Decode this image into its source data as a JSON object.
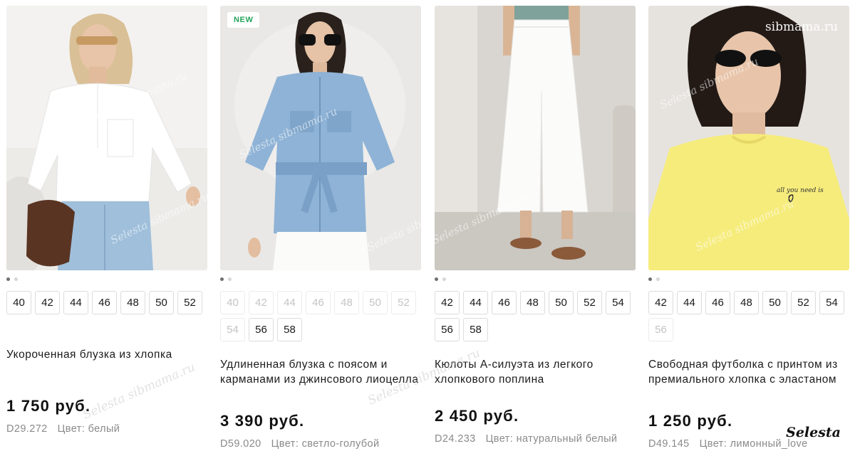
{
  "watermarks": {
    "site": "sibmama.ru",
    "brand": "Selesta sibmama.ru",
    "signature": "Selesta"
  },
  "products": [
    {
      "badge": "",
      "sizes": [
        {
          "label": "40",
          "available": true
        },
        {
          "label": "42",
          "available": true
        },
        {
          "label": "44",
          "available": true
        },
        {
          "label": "46",
          "available": true
        },
        {
          "label": "48",
          "available": true
        },
        {
          "label": "50",
          "available": true
        },
        {
          "label": "52",
          "available": true
        }
      ],
      "title": "Укороченная блузка из хлопка",
      "price": "1 750 руб.",
      "code": "D29.272",
      "color": "Цвет: белый"
    },
    {
      "badge": "NEW",
      "sizes": [
        {
          "label": "40",
          "available": false
        },
        {
          "label": "42",
          "available": false
        },
        {
          "label": "44",
          "available": false
        },
        {
          "label": "46",
          "available": false
        },
        {
          "label": "48",
          "available": false
        },
        {
          "label": "50",
          "available": false
        },
        {
          "label": "52",
          "available": false
        },
        {
          "label": "54",
          "available": false
        },
        {
          "label": "56",
          "available": true
        },
        {
          "label": "58",
          "available": true
        }
      ],
      "title": "Удлиненная блузка с поясом и карманами из джинсового лиоцелла",
      "price": "3 390 руб.",
      "code": "D59.020",
      "color": "Цвет: светло-голубой"
    },
    {
      "badge": "",
      "sizes": [
        {
          "label": "42",
          "available": true
        },
        {
          "label": "44",
          "available": true
        },
        {
          "label": "46",
          "available": true
        },
        {
          "label": "48",
          "available": true
        },
        {
          "label": "50",
          "available": true
        },
        {
          "label": "52",
          "available": true
        },
        {
          "label": "54",
          "available": true
        },
        {
          "label": "56",
          "available": true
        },
        {
          "label": "58",
          "available": true
        }
      ],
      "title": "Кюлоты А-силуэта из легкого хлопкового поплина",
      "price": "2 450 руб.",
      "code": "D24.233",
      "color": "Цвет: натуральный белый"
    },
    {
      "badge": "",
      "sizes": [
        {
          "label": "42",
          "available": true
        },
        {
          "label": "44",
          "available": true
        },
        {
          "label": "46",
          "available": true
        },
        {
          "label": "48",
          "available": true
        },
        {
          "label": "50",
          "available": true
        },
        {
          "label": "52",
          "available": true
        },
        {
          "label": "54",
          "available": true
        },
        {
          "label": "56",
          "available": false
        }
      ],
      "title": "Свободная футболка с принтом из премиального хлопка с эластаном",
      "price": "1 250 руб.",
      "code": "D49.145",
      "color": "Цвет: лимонный_love"
    }
  ],
  "print_text": "all you need is",
  "colors": {
    "badge_text": "#23a35a",
    "dot_active": "#6e6e6e",
    "dot_inactive": "#d6d6d6",
    "size_unavailable": "#c4c4c4",
    "meta_text": "#8a8a8a"
  }
}
